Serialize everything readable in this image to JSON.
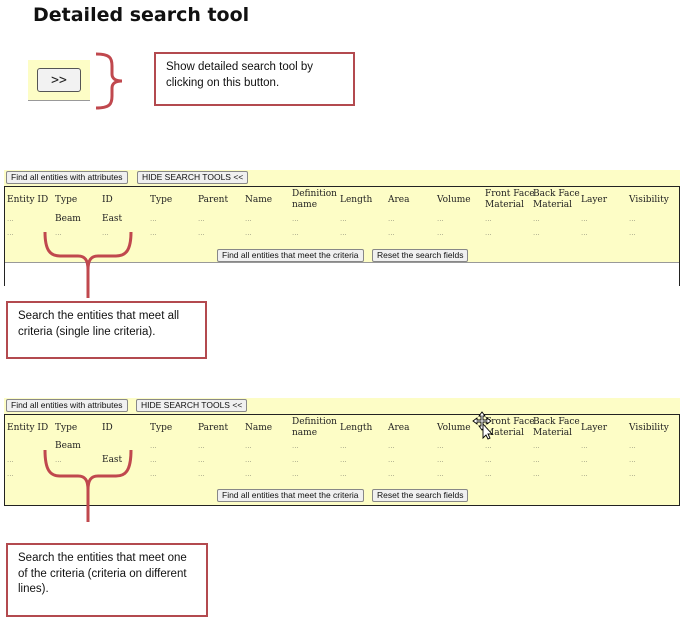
{
  "page": {
    "title": "Detailed search tool"
  },
  "demo": {
    "expand_button_label": ">>"
  },
  "callouts": {
    "show_tool": "Show detailed search tool by clicking on this button.",
    "meet_all": "Search the entities that meet all criteria (single line criteria).",
    "meet_one": "Search the entities that meet one of the criteria (criteria on different lines)."
  },
  "toolbar": {
    "find_with_attributes": "Find all entities with attributes",
    "hide_tools": "HIDE SEARCH TOOLS <<",
    "find_criteria": "Find all entities that meet the criteria",
    "reset_fields": "Reset the search fields"
  },
  "columns": {
    "entity_id": "Entity ID",
    "type1": "Type",
    "id": "ID",
    "type2": "Type",
    "parent": "Parent",
    "name": "Name",
    "definition_name_1": "Definition",
    "definition_name_2": "name",
    "length": "Length",
    "area": "Area",
    "volume": "Volume",
    "front_face_1": "Front Face",
    "front_face_2": "Material",
    "back_face_1": "Back Face",
    "back_face_2": "Material",
    "layer": "Layer",
    "visibility": "Visibility"
  },
  "values": {
    "beam": "Beam",
    "east": "East",
    "placeholder": "..."
  },
  "colors": {
    "panel_bg": "#fdfdc6",
    "callout_border": "#b34a4f"
  }
}
